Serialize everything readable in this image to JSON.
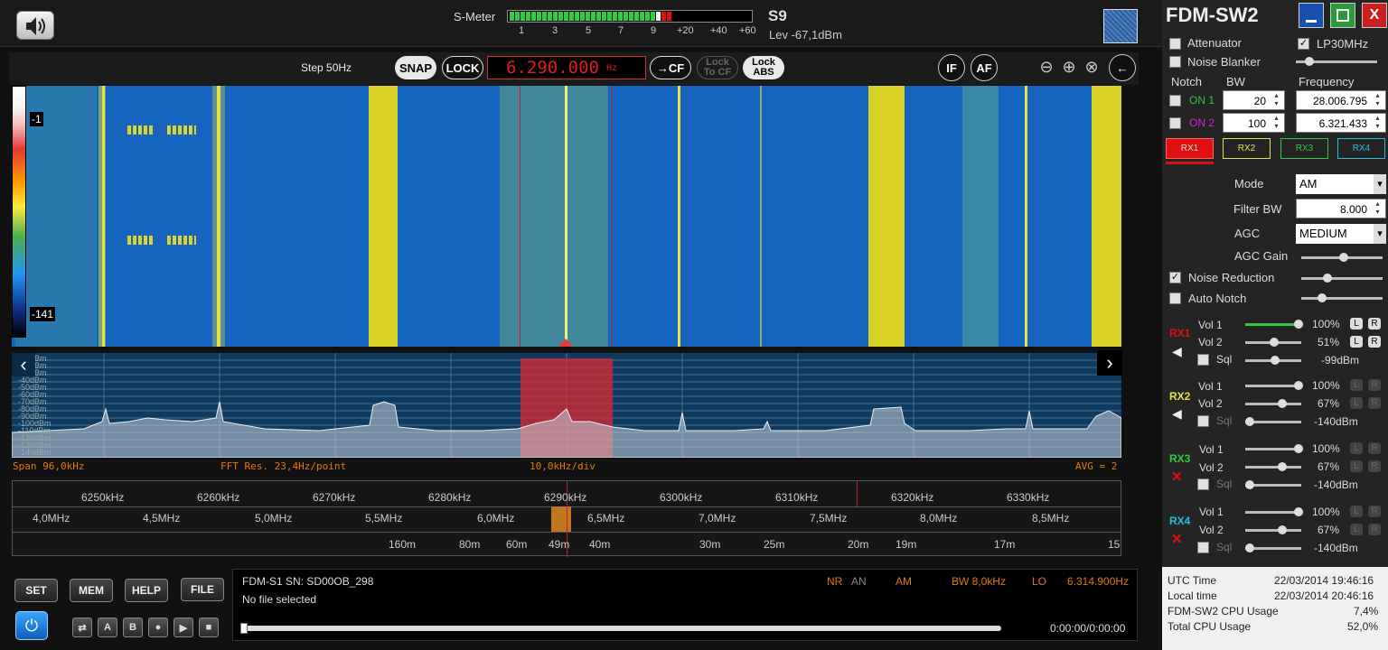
{
  "smeter": {
    "label": "S-Meter",
    "ticks": [
      "1",
      "3",
      "5",
      "7",
      "9",
      "+20",
      "+40",
      "+60"
    ],
    "s_reading": "S9",
    "level": "Lev -67,1dBm"
  },
  "control": {
    "step": "Step 50Hz",
    "snap": "SNAP",
    "lock": "LOCK",
    "frequency": "6.290.000",
    "freq_unit": "Hz",
    "to_cf": "→CF",
    "lock_to_cf_1": "Lock",
    "lock_to_cf_2": "To CF",
    "lock_abs_1": "Lock",
    "lock_abs_2": "ABS",
    "if": "IF",
    "af": "AF"
  },
  "waterfall": {
    "top_label": "-1",
    "bottom_label": "-141"
  },
  "spectrum": {
    "db_labels": [
      "-10dBm",
      "-20dBm",
      "-30dBm",
      "-40dBm",
      "-50dBm",
      "-60dBm",
      "-70dBm",
      "-80dBm",
      "-90dBm",
      "-100dBm",
      "-110dBm",
      "-120dBm",
      "-130dBm",
      "-140dBm"
    ],
    "span": "Span 96,0kHz",
    "fft_res": "FFT Res. 23,4Hz/point",
    "div": "10,0kHz/div",
    "avg": "AVG = 2"
  },
  "scale": {
    "khz": [
      "6250kHz",
      "6260kHz",
      "6270kHz",
      "6280kHz",
      "6290kHz",
      "6300kHz",
      "6310kHz",
      "6320kHz",
      "6330kHz"
    ],
    "mhz": [
      "4,0MHz",
      "4,5MHz",
      "5,0MHz",
      "5,5MHz",
      "6,0MHz",
      "6,5MHz",
      "7,0MHz",
      "7,5MHz",
      "8,0MHz",
      "8,5MHz"
    ],
    "bands": [
      "160m",
      "80m",
      "60m",
      "49m",
      "40m",
      "30m",
      "25m",
      "20m",
      "19m",
      "17m",
      "15"
    ]
  },
  "bottom": {
    "set": "SET",
    "mem": "MEM",
    "help": "HELP",
    "file": "FILE",
    "transport": [
      "A",
      "B"
    ]
  },
  "status": {
    "device": "FDM-S1 SN: SD00OB_298",
    "file": "No file selected",
    "nr": "NR",
    "an": "AN",
    "mode": "AM",
    "bw": "BW 8,0kHz",
    "lo": "LO",
    "lo_freq": "6.314.900Hz",
    "time": "0:00:00/0:00:00"
  },
  "panel": {
    "title": "FDM-SW2",
    "attenuator": "Attenuator",
    "lp30": "LP30MHz",
    "noise_blanker": "Noise Blanker",
    "notch": "Notch",
    "bw": "BW",
    "frequency": "Frequency",
    "on1": "ON 1",
    "on2": "ON 2",
    "notch1_bw": "20",
    "notch1_freq": "28.006.795",
    "notch2_bw": "100",
    "notch2_freq": "6.321.433",
    "rx": [
      "RX1",
      "RX2",
      "RX3",
      "RX4"
    ],
    "mode_label": "Mode",
    "mode": "AM",
    "filter_label": "Filter BW",
    "filter": "8.000",
    "agc_label": "AGC",
    "agc": "MEDIUM",
    "agc_gain": "AGC Gain",
    "noise_reduction": "Noise Reduction",
    "auto_notch": "Auto Notch",
    "vol1": "Vol 1",
    "vol2": "Vol 2",
    "sql": "Sql",
    "lbtn": "L",
    "rbtn": "R",
    "rx1": {
      "v1": "100%",
      "v2": "51%",
      "sql": "-99dBm"
    },
    "rx2": {
      "v1": "100%",
      "v2": "67%",
      "sql": "-140dBm"
    },
    "rx3": {
      "v1": "100%",
      "v2": "67%",
      "sql": "-140dBm"
    },
    "rx4": {
      "v1": "100%",
      "v2": "67%",
      "sql": "-140dBm"
    }
  },
  "sysinfo": {
    "utc_label": "UTC Time",
    "utc": "22/03/2014 19:46:16",
    "local_label": "Local time",
    "local": "22/03/2014 20:46:16",
    "cpu_label": "FDM-SW2 CPU Usage",
    "cpu": "7,4%",
    "total_label": "Total CPU Usage",
    "total": "52,0%"
  }
}
